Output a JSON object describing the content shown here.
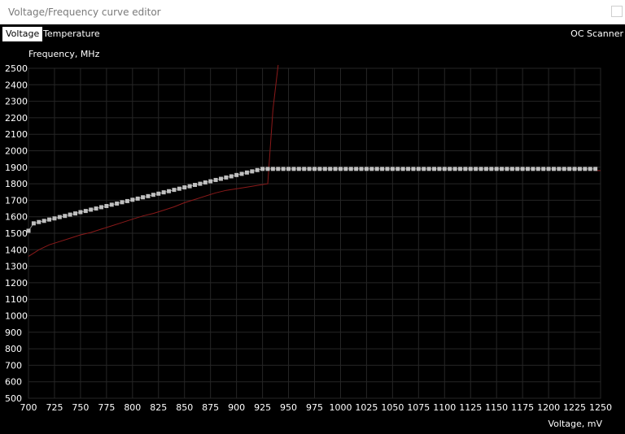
{
  "window": {
    "title": "Voltage/Frequency curve editor"
  },
  "tabs": [
    {
      "label": "Voltage",
      "active": true
    },
    {
      "label": "Temperature",
      "active": false
    }
  ],
  "oc_scanner_label": "OC Scanner",
  "chart_data": {
    "type": "line",
    "ylabel": "Frequency, MHz",
    "xlabel": "Voltage, mV",
    "xlim": [
      700,
      1250
    ],
    "ylim": [
      500,
      2500
    ],
    "x_ticks": [
      700,
      725,
      750,
      775,
      800,
      825,
      850,
      875,
      900,
      925,
      950,
      975,
      1000,
      1025,
      1050,
      1075,
      1100,
      1125,
      1150,
      1175,
      1200,
      1225,
      1250
    ],
    "y_ticks": [
      500,
      600,
      700,
      800,
      900,
      1000,
      1100,
      1200,
      1300,
      1400,
      1500,
      1600,
      1700,
      1800,
      1900,
      2000,
      2100,
      2200,
      2300,
      2400,
      2500
    ],
    "grid": true,
    "series": [
      {
        "style": "markers",
        "color": "#bfbfbf",
        "x": [
          700,
          705,
          710,
          715,
          720,
          725,
          730,
          735,
          740,
          745,
          750,
          755,
          760,
          765,
          770,
          775,
          780,
          785,
          790,
          795,
          800,
          805,
          810,
          815,
          820,
          825,
          830,
          835,
          840,
          845,
          850,
          855,
          860,
          865,
          870,
          875,
          880,
          885,
          890,
          895,
          900,
          905,
          910,
          915,
          920,
          925,
          930,
          935,
          940,
          945,
          950,
          955,
          960,
          965,
          970,
          975,
          980,
          985,
          990,
          995,
          1000,
          1005,
          1010,
          1015,
          1020,
          1025,
          1030,
          1035,
          1040,
          1045,
          1050,
          1055,
          1060,
          1065,
          1070,
          1075,
          1080,
          1085,
          1090,
          1095,
          1100,
          1105,
          1110,
          1115,
          1120,
          1125,
          1130,
          1135,
          1140,
          1145,
          1150,
          1155,
          1160,
          1165,
          1170,
          1175,
          1180,
          1185,
          1190,
          1195,
          1200,
          1205,
          1210,
          1215,
          1220,
          1225,
          1230,
          1235,
          1240,
          1245
        ],
        "values": [
          1515,
          1560,
          1568,
          1575,
          1583,
          1590,
          1598,
          1605,
          1613,
          1620,
          1628,
          1635,
          1643,
          1650,
          1658,
          1665,
          1673,
          1680,
          1688,
          1695,
          1703,
          1710,
          1718,
          1725,
          1733,
          1740,
          1748,
          1755,
          1763,
          1770,
          1778,
          1785,
          1793,
          1800,
          1808,
          1815,
          1823,
          1830,
          1838,
          1845,
          1853,
          1860,
          1868,
          1875,
          1883,
          1890,
          1890,
          1890,
          1890,
          1890,
          1890,
          1890,
          1890,
          1890,
          1890,
          1890,
          1890,
          1890,
          1890,
          1890,
          1890,
          1890,
          1890,
          1890,
          1890,
          1890,
          1890,
          1890,
          1890,
          1890,
          1890,
          1890,
          1890,
          1890,
          1890,
          1890,
          1890,
          1890,
          1890,
          1890,
          1890,
          1890,
          1890,
          1890,
          1890,
          1890,
          1890,
          1890,
          1890,
          1890,
          1890,
          1890,
          1890,
          1890,
          1890,
          1890,
          1890,
          1890,
          1890,
          1890,
          1890,
          1890,
          1890,
          1890,
          1890,
          1890,
          1890,
          1890,
          1890,
          1890
        ]
      },
      {
        "style": "line",
        "color": "#8b1a1a",
        "x": [
          700,
          705,
          710,
          720,
          730,
          740,
          750,
          760,
          770,
          780,
          790,
          800,
          810,
          820,
          830,
          840,
          850,
          860,
          870,
          880,
          890,
          900,
          910,
          920,
          930,
          935,
          940
        ],
        "values": [
          1360,
          1380,
          1400,
          1430,
          1450,
          1470,
          1490,
          1505,
          1525,
          1545,
          1565,
          1585,
          1605,
          1620,
          1640,
          1660,
          1685,
          1705,
          1725,
          1745,
          1760,
          1770,
          1780,
          1790,
          1800,
          2250,
          2520
        ]
      },
      {
        "style": "line",
        "color": "#8b1a1a",
        "x": [
          1245,
          1250
        ],
        "values": [
          1880,
          1880
        ]
      }
    ]
  }
}
